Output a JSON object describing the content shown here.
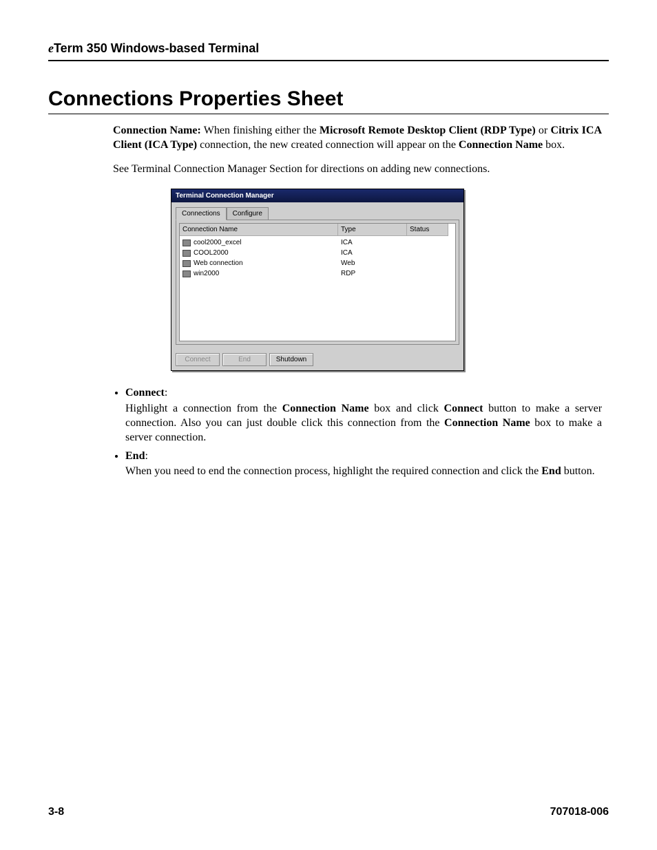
{
  "header": {
    "prefix_italic": "e",
    "rest": "Term 350 Windows-based Terminal"
  },
  "section_title": "Connections Properties Sheet",
  "para1": {
    "lead_bold": "Connection Name:",
    "t1": " When finishing either the ",
    "b1": "Microsoft Remote Desktop Client (RDP Type)",
    "t2": " or ",
    "b2": "Citrix ICA Client (ICA Type)",
    "t3": " connection, the new created connection will appear on the ",
    "b3": "Connection Name",
    "t4": " box."
  },
  "para2": "See Terminal Connection Manager Section for directions on adding new connections.",
  "dialog": {
    "title": "Terminal Connection Manager",
    "tabs": {
      "active": "Connections",
      "inactive": "Configure"
    },
    "columns": {
      "name": "Connection Name",
      "type": "Type",
      "status": "Status"
    },
    "rows": [
      {
        "name": "cool2000_excel",
        "type": "ICA",
        "status": ""
      },
      {
        "name": "COOL2000",
        "type": "ICA",
        "status": ""
      },
      {
        "name": "Web connection",
        "type": "Web",
        "status": ""
      },
      {
        "name": "win2000",
        "type": "RDP",
        "status": ""
      }
    ],
    "buttons": {
      "connect": "Connect",
      "end": "End",
      "shutdown": "Shutdown"
    }
  },
  "bullets": {
    "connect": {
      "label": "Connect",
      "t1": "Highlight a connection from the ",
      "b1": "Connection Name",
      "t2": " box and click ",
      "b2": "Connect",
      "t3": " button to make a server connection. Also you can just double click this  connection  from the ",
      "b3": "Connection Name",
      "t4": " box to make a server connection."
    },
    "end": {
      "label": "End",
      "t1": "When you need to end the connection process, highlight the required connection and click the ",
      "b1": "End",
      "t2": " button."
    }
  },
  "footer": {
    "page": "3-8",
    "doc": "707018-006"
  }
}
